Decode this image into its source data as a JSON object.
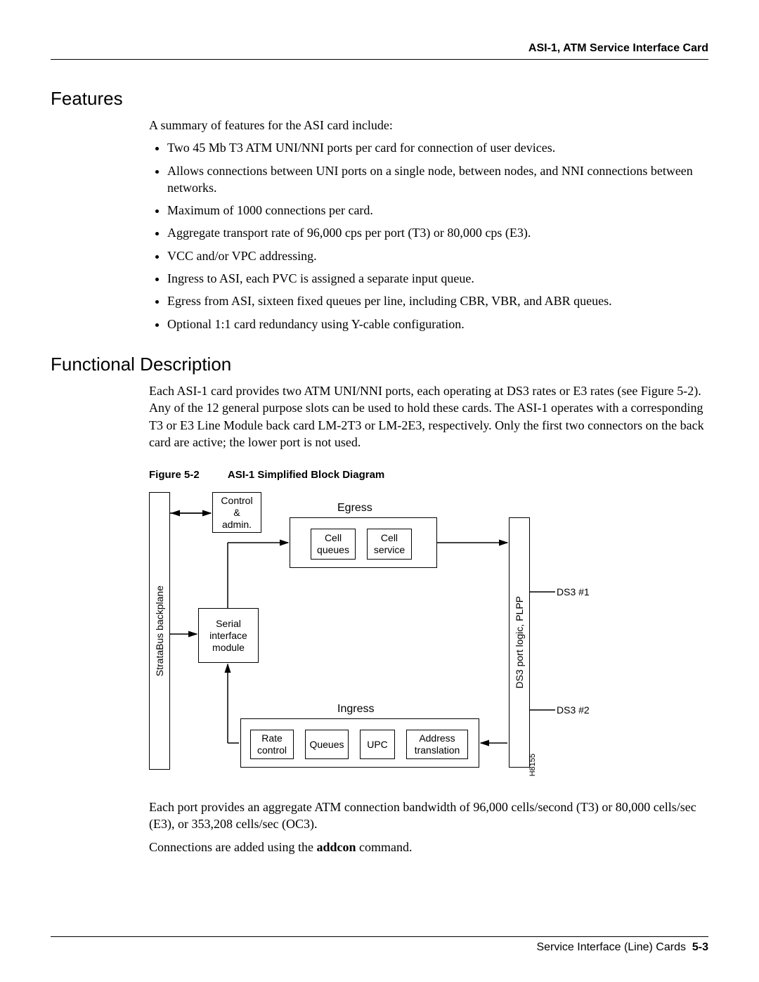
{
  "header": {
    "right": "ASI-1, ATM Service Interface Card"
  },
  "sections": {
    "features": {
      "title": "Features",
      "intro": "A summary of features for the ASI card include:",
      "items": [
        "Two 45 Mb T3 ATM UNI/NNI ports per card for connection of user devices.",
        "Allows connections between UNI ports on a single node, between nodes, and NNI connections between networks.",
        "Maximum of 1000 connections per card.",
        "Aggregate transport rate of 96,000 cps per port (T3) or 80,000 cps (E3).",
        "VCC and/or VPC addressing.",
        "Ingress to ASI, each PVC is assigned a separate input queue.",
        "Egress from ASI, sixteen fixed queues per line, including CBR, VBR, and ABR queues.",
        "Optional 1:1 card redundancy using Y-cable configuration."
      ]
    },
    "funcdesc": {
      "title": "Functional Description",
      "para1": "Each ASI-1 card provides two ATM UNI/NNI ports, each operating at DS3 rates or E3 rates (see Figure 5-2). Any of the 12 general purpose slots can be used to hold these cards. The ASI-1 operates with a corresponding T3 or E3 Line Module back card LM-2T3 or LM-2E3, respectively. Only the first two connectors on the back card are active; the lower port is not used."
    }
  },
  "figure": {
    "label": "Figure 5-2",
    "title": "ASI-1 Simplified Block Diagram",
    "labels": {
      "egress": "Egress",
      "ingress": "Ingress",
      "backplane": "StrataBus backplane",
      "portlogic": "DS3 port logic, PLPP",
      "ds3_1": "DS3 #1",
      "ds3_2": "DS3 #2",
      "control": "Control\n&\nadmin.",
      "cell_queues": "Cell\nqueues",
      "cell_service": "Cell\nservice",
      "sim": "Serial\ninterface\nmodule",
      "rate_control": "Rate\ncontrol",
      "queues": "Queues",
      "upc": "UPC",
      "addr_trans": "Address\ntranslation",
      "figid": "H8155"
    }
  },
  "after_figure": {
    "para1": "Each port provides an aggregate ATM connection bandwidth of 96,000 cells/second (T3) or 80,000 cells/sec (E3), or 353,208 cells/sec (OC3).",
    "para2_pre": "Connections are added using the ",
    "para2_bold": "addcon",
    "para2_post": " command."
  },
  "footer": {
    "text": "Service Interface (Line) Cards",
    "pagenum": "5-3"
  }
}
